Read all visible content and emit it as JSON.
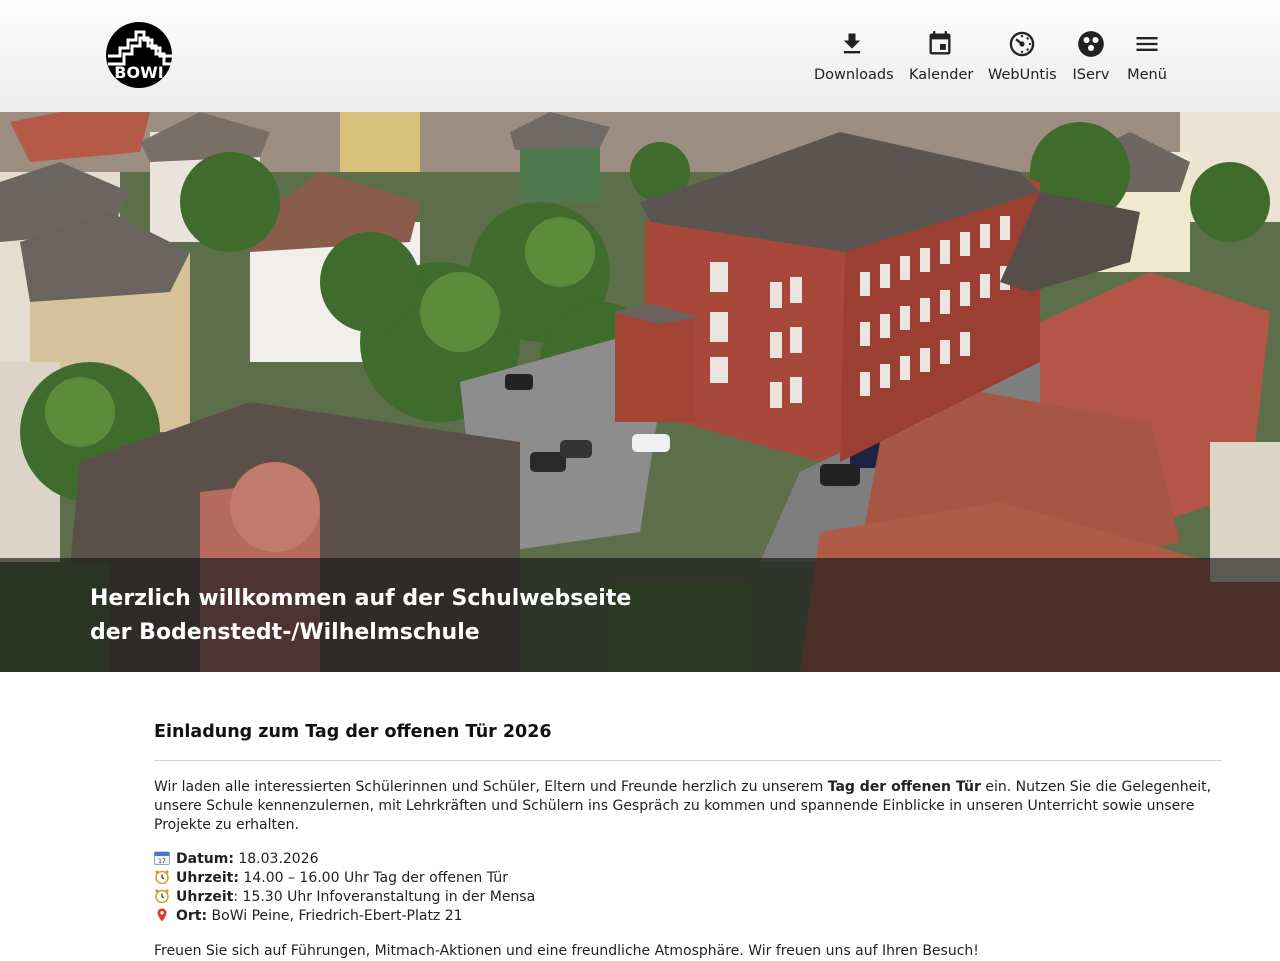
{
  "header": {
    "logo_text": "BOWI",
    "nav": [
      {
        "label": "Downloads",
        "icon": "download-icon"
      },
      {
        "label": "Kalender",
        "icon": "calendar-icon"
      },
      {
        "label": "WebUntis",
        "icon": "webuntis-icon"
      },
      {
        "label": "IServ",
        "icon": "iserv-icon"
      },
      {
        "label": "Menü",
        "icon": "hamburger-menu-icon"
      }
    ]
  },
  "hero": {
    "title_line1": "Herzlich willkommen auf der Schulwebseite",
    "title_line2": "der Bodenstedt-/Wilhelmschule"
  },
  "article": {
    "title": "Einladung zum Tag der offenen Tür 2026",
    "intro_before": "Wir laden alle interessierten Schülerinnen und Schüler, Eltern und Freunde herzlich zu unserem ",
    "intro_bold": "Tag der offenen Tür",
    "intro_after": " ein. Nutzen Sie die Gelegenheit, unsere Schule kennenzulernen, mit Lehrkräften und Schülern ins Gespräch zu kommen und spannende Einblicke in unseren Unterricht sowie unsere Projekte zu erhalten.",
    "details": [
      {
        "icon": "calendar-emoji-icon",
        "label": "Datum:",
        "value": " 18.03.2026"
      },
      {
        "icon": "alarm-clock-emoji-icon",
        "label": "Uhrzeit:",
        "value": " 14.00 – 16.00 Uhr Tag der offenen Tür"
      },
      {
        "icon": "alarm-clock-emoji-icon",
        "label": "Uhrzeit",
        "value": ": 15.30 Uhr Infoveranstaltung in der Mensa"
      },
      {
        "icon": "location-pin-icon",
        "label": "Ort:",
        "value": " BoWi Peine, Friedrich-Ebert-Platz 21"
      }
    ],
    "closing": "Freuen Sie sich auf Führungen, Mitmach-Aktionen und eine freundliche Atmosphäre. Wir freuen uns auf Ihren Besuch!"
  },
  "colors": {
    "header_bg": "#f2f2f2",
    "caption_overlay": "#191919",
    "brick": "#a8483a"
  }
}
